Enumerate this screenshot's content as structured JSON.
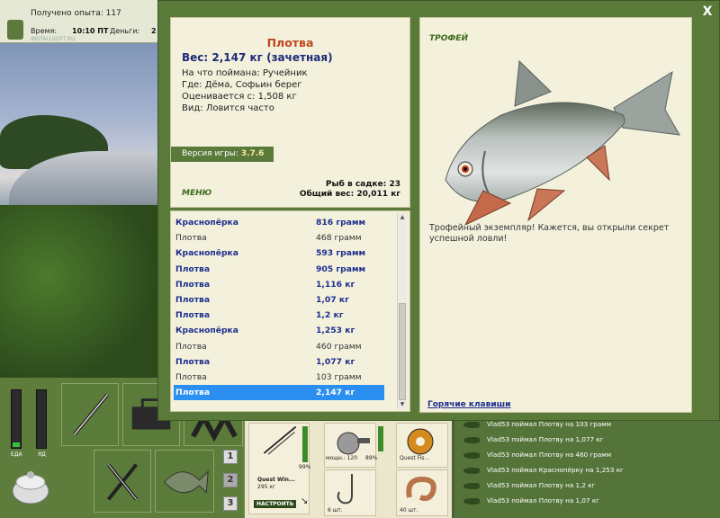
{
  "status": {
    "xp": "Получено опыта: 117",
    "time_label": "Время:",
    "time_value": "10:10 ПТ",
    "money_label": "Деньги:",
    "money_value": "2",
    "watermark": "INSTALLSOFT.RU"
  },
  "gauges": {
    "food_label": "ЕДА",
    "food_level": 0.08,
    "poison_label": "ЯД",
    "poison_level": 0.0
  },
  "page_buttons": [
    "1",
    "2",
    "3"
  ],
  "dialog": {
    "close": "X",
    "fish_name": "Плотва",
    "weight": "Вес: 2,147 кг (зачетная)",
    "caught_with": "На что поймана: Ручейник",
    "where": "Где: Дёма, Софьин берег",
    "valued_from": "Оценивается с: 1,508 кг",
    "kind": "Вид: Ловится часто",
    "version_label": "Версия игры:",
    "version_value": "3.7.6",
    "menu": "МЕНЮ",
    "fish_in_keepnet": "Рыб в садке: 23",
    "total_weight": "Общий вес: 20,011 кг"
  },
  "catch_list": [
    {
      "fish": "Краснопёрка",
      "weight": "816 грамм",
      "style": "hl"
    },
    {
      "fish": "Плотва",
      "weight": "468 грамм",
      "style": "nm"
    },
    {
      "fish": "Краснопёрка",
      "weight": "593 грамм",
      "style": "hl"
    },
    {
      "fish": "Плотва",
      "weight": "905 грамм",
      "style": "hl"
    },
    {
      "fish": "Плотва",
      "weight": "1,116 кг",
      "style": "hl"
    },
    {
      "fish": "Плотва",
      "weight": "1,07 кг",
      "style": "hl"
    },
    {
      "fish": "Плотва",
      "weight": "1,2 кг",
      "style": "hl"
    },
    {
      "fish": "Краснопёрка",
      "weight": "1,253 кг",
      "style": "hl"
    },
    {
      "fish": "Плотва",
      "weight": "460 грамм",
      "style": "nm"
    },
    {
      "fish": "Плотва",
      "weight": "1,077 кг",
      "style": "hl"
    },
    {
      "fish": "Плотва",
      "weight": "103 грамм",
      "style": "nm"
    },
    {
      "fish": "Плотва",
      "weight": "2,147 кг",
      "style": "sel"
    }
  ],
  "trophy": {
    "label": "ТРОФЕЙ",
    "description": "Трофейный экземпляр! Кажется, вы открыли секрет успешной ловли!",
    "hotkeys": "Горячие клавиши"
  },
  "equipment": {
    "rod_percent": "99%",
    "rod_name": "Quest Win...",
    "rod_weight": "295 кг",
    "setup_button": "НАСТРОИТЬ",
    "reel_power": "мощн.: 120",
    "reel_percent": "89%",
    "line_name": "Quest Fis...",
    "hooks_count": "6 шт.",
    "bait_count": "40 шт."
  },
  "chat": [
    "Vlad53 поймал Плотву на 103 грамм",
    "Vlad53 поймал Плотву на 1,077 кг",
    "Vlad53 поймал Плотву на 460 грамм",
    "Vlad53 поймал Краснопёрку на 1,253 кг",
    "Vlad53 поймал Плотву на 1,2 кг",
    "Vlad53 поймал Плотву на 1,07 кг"
  ],
  "colors": {
    "panel_green": "#5a7a3a",
    "paper": "#f3f1dc",
    "fish_name": "#c0471e",
    "highlight_text": "#1d2e8f",
    "selection": "#2a8ff0"
  }
}
